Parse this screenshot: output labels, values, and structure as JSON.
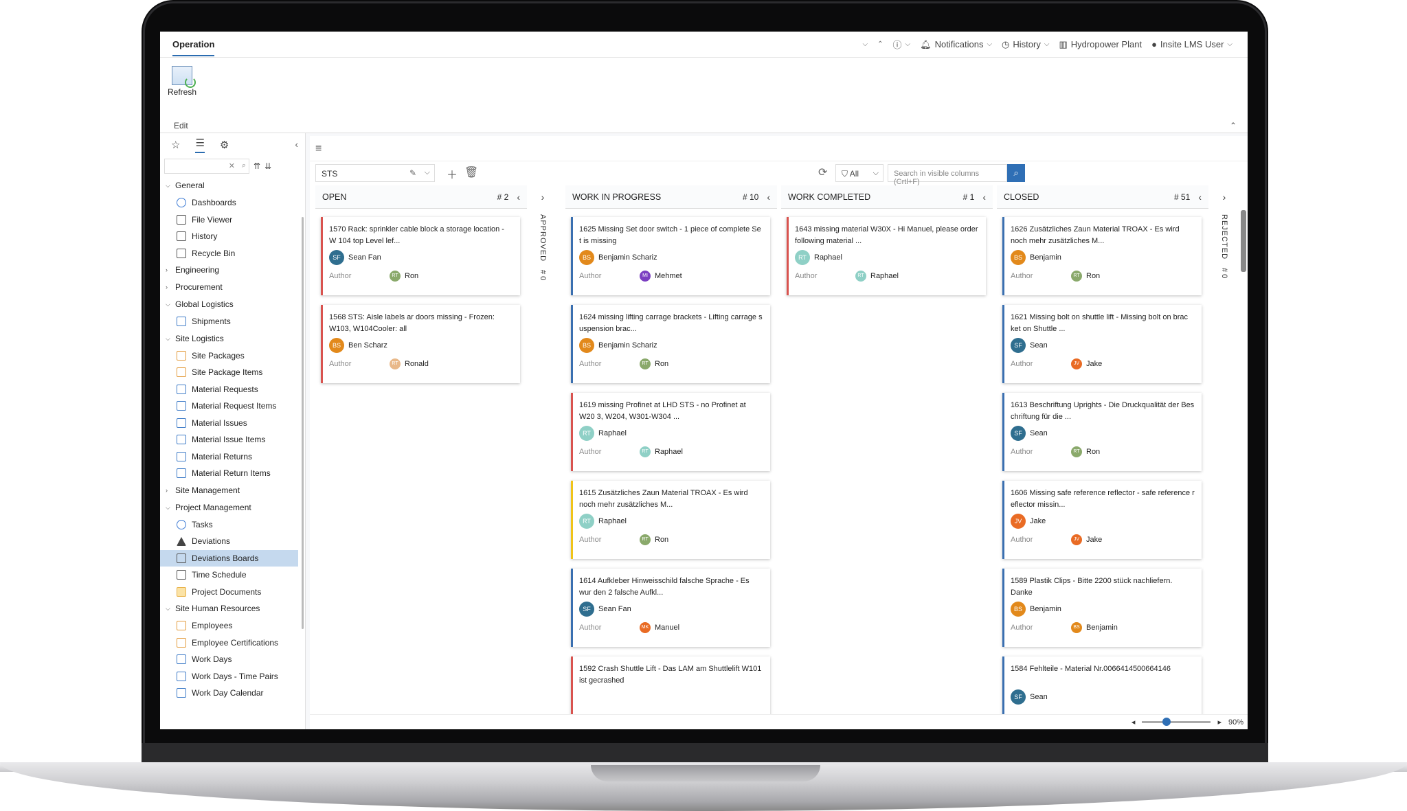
{
  "app": {
    "tab": "Operation",
    "top_items": [
      "Notifications",
      "History",
      "Hydropower Plant",
      "Insite LMS User"
    ]
  },
  "ribbon": {
    "refresh": "Refresh",
    "group": "Edit"
  },
  "tree": [
    {
      "group": "General",
      "open": true,
      "items": [
        "Dashboards",
        "File Viewer",
        "History",
        "Recycle Bin"
      ]
    },
    {
      "group": "Engineering",
      "open": false,
      "items": []
    },
    {
      "group": "Procurement",
      "open": false,
      "items": []
    },
    {
      "group": "Global Logistics",
      "open": true,
      "items": [
        "Shipments"
      ]
    },
    {
      "group": "Site Logistics",
      "open": true,
      "items": [
        "Site Packages",
        "Site Package Items",
        "Material Requests",
        "Material Request Items",
        "Material Issues",
        "Material Issue Items",
        "Material Returns",
        "Material Return Items"
      ]
    },
    {
      "group": "Site Management",
      "open": false,
      "items": []
    },
    {
      "group": "Project Management",
      "open": true,
      "items": [
        "Tasks",
        "Deviations",
        "Deviations Boards",
        "Time Schedule",
        "Project Documents"
      ]
    },
    {
      "group": "Site Human Resources",
      "open": true,
      "items": [
        "Employees",
        "Employee Certifications",
        "Work Days",
        "Work Days - Time Pairs",
        "Work Day Calendar"
      ]
    }
  ],
  "selected_item": "Deviations Boards",
  "toolbar": {
    "filter": "STS",
    "all": "All",
    "search_placeholder": "Search in visible columns (Crtl+F)"
  },
  "columns": {
    "open": {
      "title": "OPEN",
      "count": "# 2"
    },
    "approved": {
      "title": "APPROVED",
      "count": "# 0"
    },
    "wip": {
      "title": "WORK IN PROGRESS",
      "count": "# 10"
    },
    "completed": {
      "title": "WORK COMPLETED",
      "count": "# 1"
    },
    "closed": {
      "title": "CLOSED",
      "count": "# 51"
    },
    "rejected": {
      "title": "REJECTED",
      "count": "# 0"
    }
  },
  "author_label": "Author",
  "cards": {
    "open": [
      {
        "text": "1570  Rack: sprinkler cable block a storage location - W 104 top Level lef...",
        "assignee": "Sean Fan",
        "ai": "SF",
        "ac": "#2f6e8f",
        "author": "Ron",
        "bi": "RT",
        "bc": "#8aa96b"
      },
      {
        "text": "1568  STS: Aisle labels ar doors missing - Frozen: W103, W104Cooler: all",
        "assignee": "Ben Scharz",
        "ai": "BS",
        "ac": "#e2891b",
        "author": "Ronald",
        "bi": "RT",
        "bc": "#e9b98a"
      }
    ],
    "wip": [
      {
        "text": "1625  Missing Set door switch - 1 piece of complete Se t is missing",
        "assignee": "Benjamin Schariz",
        "ai": "BS",
        "ac": "#e2891b",
        "author": "Mehmet",
        "bi": "MI",
        "bc": "#7b3fc1",
        "color": "blue"
      },
      {
        "text": "1624  missing lifting carrage brackets - Lifting carrage s uspension brac...",
        "assignee": "Benjamin Schariz",
        "ai": "BS",
        "ac": "#e2891b",
        "author": "Ron",
        "bi": "RT",
        "bc": "#8aa96b",
        "color": "blue"
      },
      {
        "text": "1619  missing Profinet at LHD STS - no Profinet at W20 3, W204, W301-W304 ...",
        "assignee": "Raphael",
        "ai": "RT",
        "ac": "#8fd0c6",
        "author": "Raphael",
        "bi": "RT",
        "bc": "#8fd0c6",
        "color": "red"
      },
      {
        "text": "1615  Zusätzliches Zaun Material TROAX - Es wird noch mehr zusätzliches M...",
        "assignee": "Raphael",
        "ai": "RT",
        "ac": "#8fd0c6",
        "author": "Ron",
        "bi": "RT",
        "bc": "#8aa96b",
        "color": "yellow"
      },
      {
        "text": "1614  Aufkleber Hinweisschild falsche Sprache - Es wur den 2 falsche Aufkl...",
        "assignee": "Sean Fan",
        "ai": "SF",
        "ac": "#2f6e8f",
        "author": "Manuel",
        "bi": "MK",
        "bc": "#e96b24",
        "color": "blue"
      },
      {
        "text": "1592  Crash Shuttle Lift - Das LAM am Shuttlelift W101 ist gecrashed",
        "assignee": "",
        "ai": "",
        "ac": "#2f6e8f",
        "author": "",
        "bi": "",
        "bc": "#8aa96b",
        "color": "red"
      }
    ],
    "completed": [
      {
        "text": "1643  missing material W30X - Hi Manuel, please order following material ...",
        "assignee": "Raphael",
        "ai": "RT",
        "ac": "#8fd0c6",
        "author": "Raphael",
        "bi": "RT",
        "bc": "#8fd0c6",
        "color": "red"
      }
    ],
    "closed": [
      {
        "text": "1626  Zusätzliches Zaun Material TROAX - Es wird noch mehr zusätzliches M...",
        "assignee": "Benjamin",
        "ai": "BS",
        "ac": "#e2891b",
        "author": "Ron",
        "bi": "RT",
        "bc": "#8aa96b",
        "color": "blue"
      },
      {
        "text": "1621  Missing bolt on shuttle lift - Missing bolt on brac ket on Shuttle ...",
        "assignee": "Sean",
        "ai": "SF",
        "ac": "#2f6e8f",
        "author": "Jake",
        "bi": "JV",
        "bc": "#e96b24",
        "color": "blue"
      },
      {
        "text": "1613  Beschriftung Uprights - Die Druckqualität der Bes chriftung für die ...",
        "assignee": "Sean",
        "ai": "SF",
        "ac": "#2f6e8f",
        "author": "Ron",
        "bi": "RT",
        "bc": "#8aa96b",
        "color": "blue"
      },
      {
        "text": "1606  Missing safe reference reflector - safe reference r eflector missin...",
        "assignee": "Jake",
        "ai": "JV",
        "ac": "#e96b24",
        "author": "Jake",
        "bi": "JV",
        "bc": "#e96b24",
        "color": "blue"
      },
      {
        "text": "1589  Plastik Clips - Bitte 2200 stück nachliefern. Danke",
        "assignee": "Benjamin",
        "ai": "BS",
        "ac": "#e2891b",
        "author": "Benjamin",
        "bi": "BS",
        "bc": "#e2891b",
        "color": "blue"
      },
      {
        "text": "1584  Fehlteile - Material Nr.0066414500664146",
        "assignee": "Sean",
        "ai": "SF",
        "ac": "#2f6e8f",
        "author": "",
        "bi": "",
        "bc": "#e2891b",
        "color": "blue"
      }
    ]
  },
  "zoom": "90%"
}
